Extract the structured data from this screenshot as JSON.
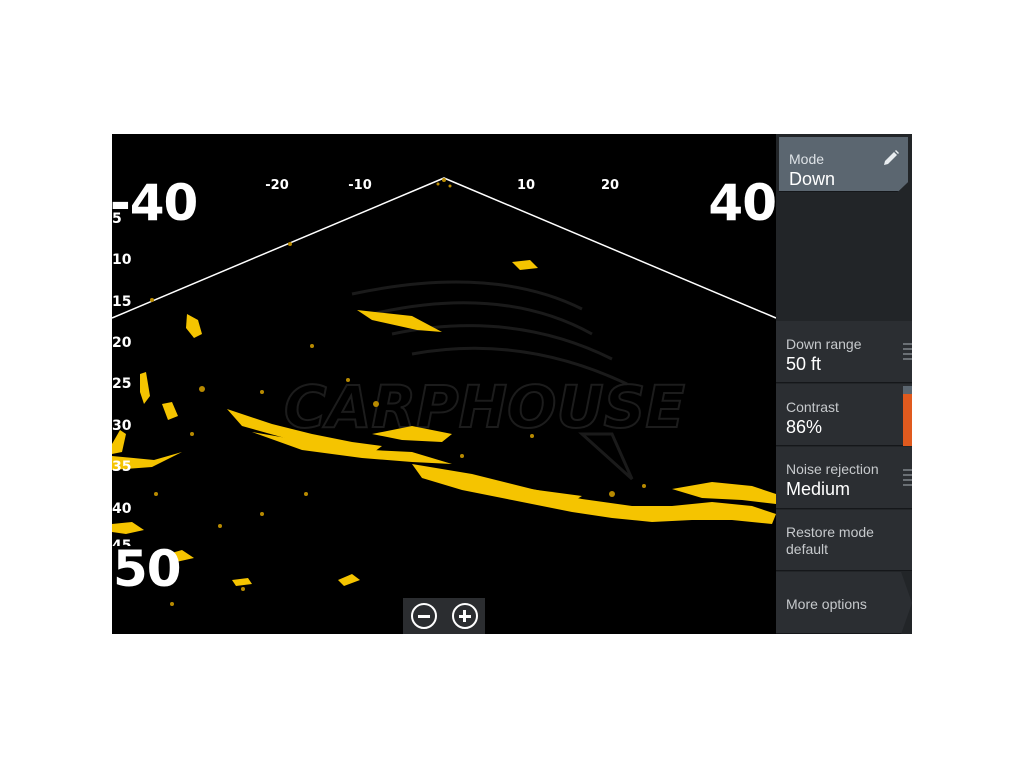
{
  "sonar": {
    "range_left": "-40",
    "range_right": "40",
    "top_ticks": [
      "-20",
      "-10",
      "10",
      "20"
    ],
    "depth_ticks": [
      "5",
      "10",
      "15",
      "20",
      "25",
      "30",
      "35",
      "40",
      "45"
    ],
    "depth_max": "50",
    "watermark": "CARPHOUSE",
    "palette": {
      "background": "#000000",
      "echo": "#f5c400",
      "echo_dim": "#b88a00",
      "cone_line": "#ffffff"
    }
  },
  "zoom": {
    "zoom_out_icon": "minus-circle-icon",
    "zoom_in_icon": "plus-circle-icon"
  },
  "menu": {
    "mode": {
      "label": "Mode",
      "value": "Down",
      "icon": "pencil-icon"
    },
    "down_range": {
      "label": "Down range",
      "value": "50 ft"
    },
    "contrast": {
      "label": "Contrast",
      "value": "86%",
      "level": 0.86,
      "accent": "#e05a1e"
    },
    "noise_rejection": {
      "label": "Noise rejection",
      "value": "Medium"
    },
    "restore": {
      "line1": "Restore mode",
      "line2": "default"
    },
    "more": {
      "label": "More options"
    }
  }
}
